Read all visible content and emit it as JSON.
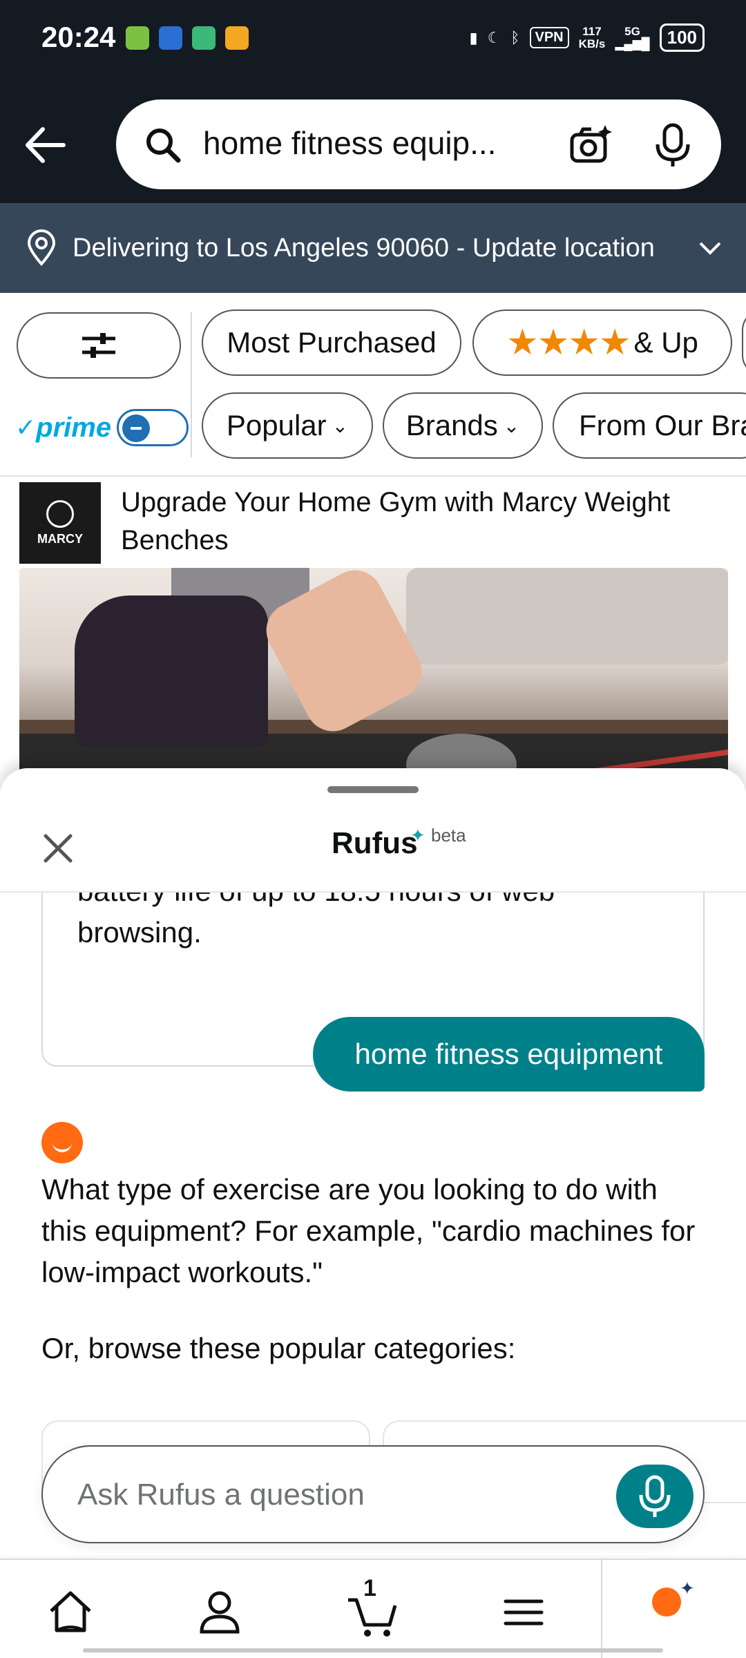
{
  "status_bar": {
    "time": "20:24",
    "vpn": "VPN",
    "speed_value": "117",
    "speed_unit": "KB/s",
    "network": "5G",
    "battery": "100"
  },
  "header": {
    "search_value": "home fitness equip..."
  },
  "location": {
    "text": "Delivering to Los Angeles 90060 - Update location"
  },
  "filters": {
    "most_purchased": "Most Purchased",
    "rating": "& Up",
    "prime": "prime",
    "popular": "Popular",
    "brands": "Brands",
    "from_our_brands": "From Our Bra"
  },
  "sponsored": {
    "brand_logo_text": "MARCY",
    "title": "Upgrade Your Home Gym with Marcy Weight Benches"
  },
  "rufus": {
    "title": "Rufus",
    "badge": "beta",
    "previous_message": "battery life of up to 18.5 hours of web browsing.",
    "user_message": "home fitness equipment",
    "answer": "What type of exercise are you looking to do with this equipment? For example, \"cardio machines for low-impact workouts.\"",
    "answer_followup": "Or, browse these popular categories:",
    "ask_placeholder": "Ask Rufus a question"
  },
  "bottom_nav": {
    "cart_count": "1"
  },
  "colors": {
    "header_bg": "#131a22",
    "location_bg": "#37475a",
    "accent_teal": "#00818a",
    "rufus_orange": "#ff6a13",
    "star": "#f08804",
    "prime_blue": "#00a8e1"
  }
}
